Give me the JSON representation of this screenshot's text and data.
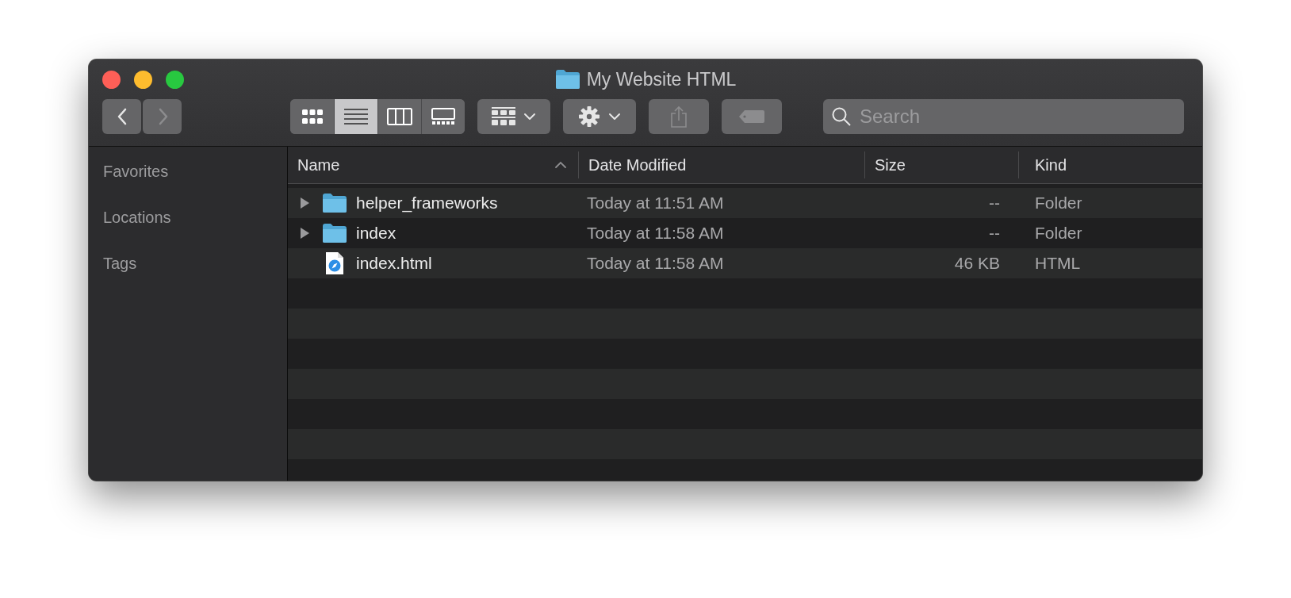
{
  "window": {
    "title": "My Website HTML"
  },
  "traffic_lights": [
    {
      "color": "#fe5f57"
    },
    {
      "color": "#febc2e"
    },
    {
      "color": "#28c840"
    }
  ],
  "toolbar": {
    "nav": [
      {
        "kind": "back",
        "disabled": false
      },
      {
        "kind": "forward",
        "disabled": true
      }
    ],
    "view_modes": [
      {
        "kind": "icons",
        "selected": false
      },
      {
        "kind": "list",
        "selected": true
      },
      {
        "kind": "columns",
        "selected": false
      },
      {
        "kind": "gallery",
        "selected": false
      }
    ],
    "buttons": [
      {
        "kind": "group",
        "disabled": false
      },
      {
        "kind": "action",
        "disabled": false
      },
      {
        "kind": "share",
        "disabled": true
      },
      {
        "kind": "tag",
        "disabled": true
      }
    ],
    "search": {
      "placeholder": "Search"
    }
  },
  "sidebar": {
    "items": [
      {
        "label": "Favorites"
      },
      {
        "label": "Locations"
      },
      {
        "label": "Tags"
      }
    ]
  },
  "table": {
    "columns": [
      {
        "label": "Name",
        "sorted": true
      },
      {
        "label": "Date Modified",
        "sorted": false
      },
      {
        "label": "Size",
        "sorted": false
      },
      {
        "label": "Kind",
        "sorted": false
      }
    ],
    "rows": [
      {
        "kind": "folder",
        "expanded": false,
        "name": "helper_frameworks",
        "date": "Today at 11:51 AM",
        "size": "--",
        "type": "Folder"
      },
      {
        "kind": "folder",
        "expanded": false,
        "name": "index",
        "date": "Today at 11:58 AM",
        "size": "--",
        "type": "Folder"
      },
      {
        "kind": "file",
        "name": "index.html",
        "date": "Today at 11:58 AM",
        "size": "46 KB",
        "type": "HTML"
      }
    ]
  }
}
